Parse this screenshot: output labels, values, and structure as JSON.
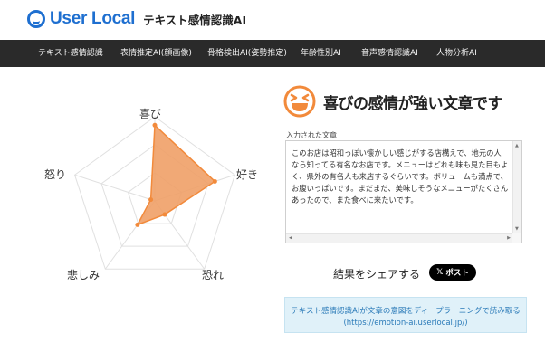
{
  "header": {
    "logo_text": "User Local",
    "subtitle": "テキスト感情認識AI"
  },
  "nav": {
    "items": [
      {
        "label": "テキスト感情認識"
      },
      {
        "label": "表情推定AI(顔画像)"
      },
      {
        "label": "骨格検出AI(姿勢推定)"
      },
      {
        "label": "年齢性別AI"
      },
      {
        "label": "音声感情認識AI"
      },
      {
        "label": "人物分析AI"
      }
    ]
  },
  "chart_data": {
    "type": "radar",
    "categories": [
      "喜び",
      "好き",
      "恐れ",
      "悲しみ",
      "怒り"
    ],
    "values": [
      0.9,
      0.75,
      0.2,
      0.35,
      0.05
    ],
    "rmax": 1.0,
    "levels": 3,
    "fill_color": "#f0a067",
    "stroke_color": "#f28a3b",
    "grid_color": "#e0e0e0"
  },
  "result": {
    "icon": "laughing-face-icon",
    "title": "喜びの感情が強い文章です",
    "accent_color": "#f28a3b"
  },
  "input": {
    "label": "入力された文章",
    "text": "このお店は昭和っぽい懐かしい感じがする店構えで、地元の人なら知ってる有名なお店です。メニューはどれも味も見た目もよく、県外の有名人も来店するぐらいです。ボリュームも満点で、お腹いっぱいです。まだまだ、美味しそうなメニューがたくさんあったので、また食べに来たいです。"
  },
  "share": {
    "label": "結果をシェアする",
    "post_label": "ポスト",
    "post_icon": "x-logo-icon"
  },
  "info": {
    "line1": "テキスト感情認識AIが文章の意図をディープラーニングで読み取る",
    "line2": "(https://emotion-ai.userlocal.jp/)"
  }
}
